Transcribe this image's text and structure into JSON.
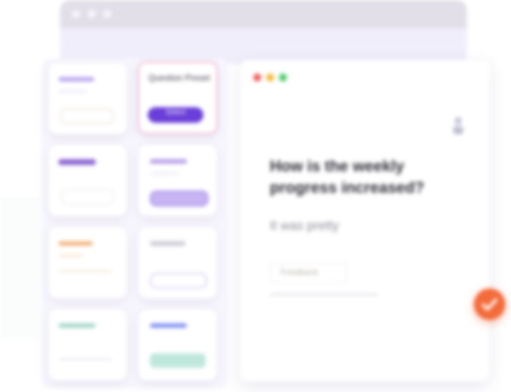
{
  "window": {
    "controls": [
      "close",
      "minimize",
      "maximize"
    ]
  },
  "selected_card": {
    "title": "Question Preset",
    "button_label": "Select"
  },
  "cards": [
    {
      "accent": "#b9a3f0"
    },
    {
      "accent": "#8a63d2"
    },
    {
      "accent": "#b69ae6"
    },
    {
      "accent": "#f3b27a"
    },
    {
      "accent": "#c8c8d2"
    },
    {
      "accent": "#9fd6c6"
    },
    {
      "accent": "#7e8ff0"
    }
  ],
  "panel": {
    "question": "How is the weekly progress increased?",
    "answer": "It was pretty",
    "chip_label": "Feedback"
  },
  "colors": {
    "brand_purple": "#6a3fd9",
    "accent_orange": "#f36b3b",
    "mint": "#bfe7dc"
  },
  "icons": [
    "user-icon",
    "check-icon"
  ]
}
